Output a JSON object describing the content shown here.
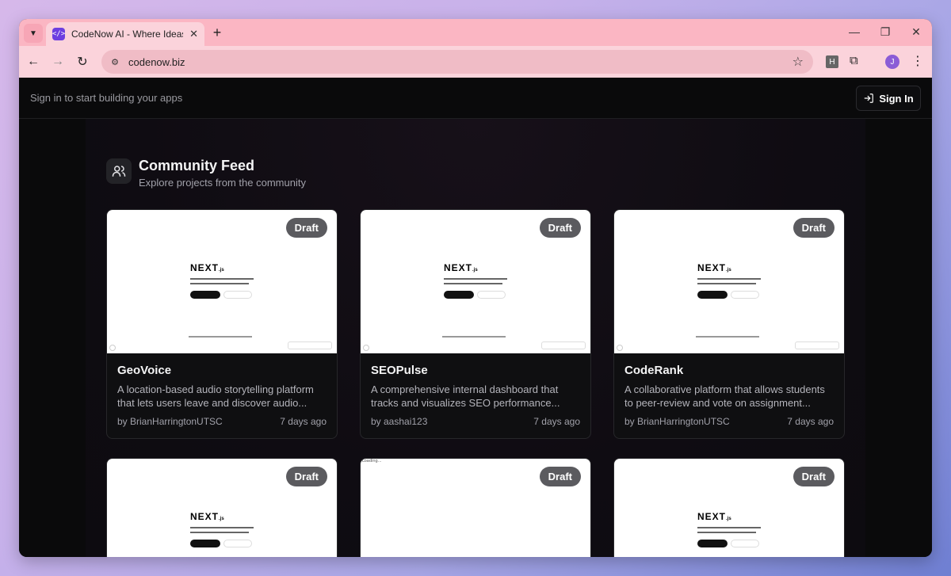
{
  "browser": {
    "tab_title": "CodeNow AI - Where Ideas Begin",
    "url": "codenow.biz",
    "profile_initial": "J",
    "extension_letter": "H",
    "favicon_text": "</>"
  },
  "header": {
    "signin_message": "Sign in to start building your apps",
    "signin_label": "Sign In"
  },
  "feed": {
    "title": "Community Feed",
    "subtitle": "Explore projects from the community"
  },
  "projects": [
    {
      "title": "GeoVoice",
      "description": "A location-based audio storytelling platform that lets users leave and discover audio...",
      "author": "by BrianHarringtonUTSC",
      "time": "7 days ago",
      "badge": "Draft"
    },
    {
      "title": "SEOPulse",
      "description": "A comprehensive internal dashboard that tracks and visualizes SEO performance...",
      "author": "by aashai123",
      "time": "7 days ago",
      "badge": "Draft"
    },
    {
      "title": "CodeRank",
      "description": "A collaborative platform that allows students to peer-review and vote on assignment...",
      "author": "by BrianHarringtonUTSC",
      "time": "7 days ago",
      "badge": "Draft"
    },
    {
      "badge": "Draft"
    },
    {
      "badge": "Draft",
      "preview_text": "Loading..."
    },
    {
      "badge": "Draft"
    }
  ],
  "preview": {
    "logo": "NEXT",
    "logo_suffix": ".js"
  }
}
